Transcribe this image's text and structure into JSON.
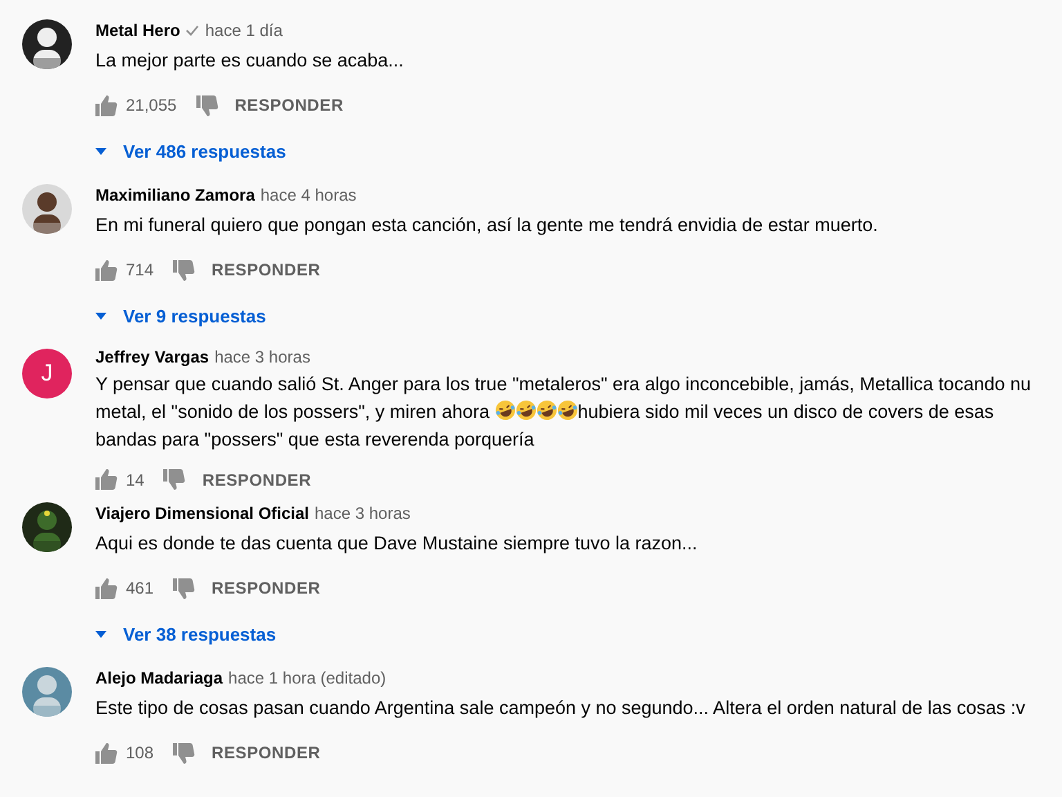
{
  "comments": [
    {
      "author": "Metal Hero",
      "verified": true,
      "time": "hace 1 día",
      "body": [
        {
          "kind": "text",
          "text": "La mejor parte es cuando se acaba..."
        }
      ],
      "likes": "21,055",
      "reply": "RESPONDER",
      "replies": "Ver 486 respuestas"
    },
    {
      "author": "Maximiliano Zamora",
      "verified": false,
      "time": "hace 4 horas",
      "body": [
        {
          "kind": "text",
          "text": "En mi funeral quiero que pongan esta canción, así la gente me tendrá envidia de estar muerto."
        }
      ],
      "likes": "714",
      "reply": "RESPONDER",
      "replies": "Ver 9 respuestas"
    },
    {
      "author": "Jeffrey Vargas",
      "verified": false,
      "time": "hace 3 horas",
      "avatar": {
        "kind": "letter",
        "letter": "J",
        "color": "#e0245e"
      },
      "body": [
        {
          "kind": "text",
          "text": "Y pensar que cuando salió St. Anger para los true \"metaleros\" era algo inconcebible, jamás, Metallica tocando nu metal, el \"sonido de los possers\", y miren ahora "
        },
        {
          "kind": "emoji"
        },
        {
          "kind": "emoji"
        },
        {
          "kind": "emoji"
        },
        {
          "kind": "emoji"
        },
        {
          "kind": "text",
          "text": "hubiera sido mil veces un disco de covers de esas bandas para \"possers\" que esta reverenda porquería"
        }
      ],
      "likes": "14",
      "reply": "RESPONDER"
    },
    {
      "author": "Viajero Dimensional Oficial",
      "verified": false,
      "time": "hace 3 horas",
      "body": [
        {
          "kind": "text",
          "text": "Aqui es donde te das cuenta que Dave Mustaine siempre tuvo la razon..."
        }
      ],
      "likes": "461",
      "reply": "RESPONDER",
      "replies": "Ver 38 respuestas"
    },
    {
      "author": "Alejo Madariaga",
      "verified": false,
      "time": "hace 1 hora (editado)",
      "body": [
        {
          "kind": "text",
          "text": "Este tipo de cosas pasan cuando Argentina sale campeón y no segundo... Altera el orden natural de las cosas :v"
        }
      ],
      "likes": "108",
      "reply": "RESPONDER"
    }
  ]
}
